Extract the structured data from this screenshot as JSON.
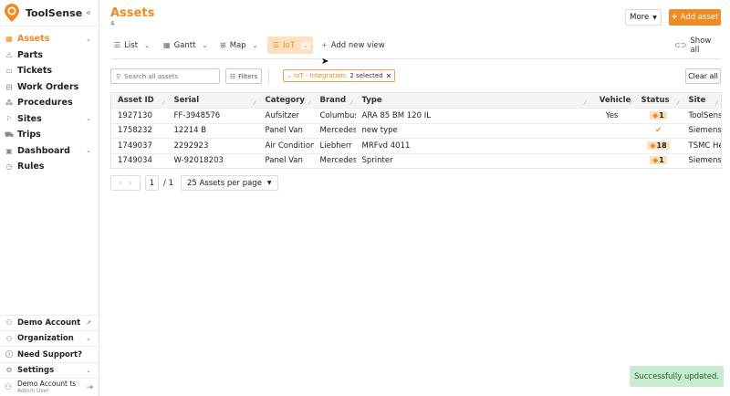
{
  "app": {
    "name": "ToolSense",
    "accent": "#f08a24"
  },
  "sidebar": {
    "items": [
      {
        "label": "Assets",
        "icon": "grid-icon",
        "chevron": true,
        "active": true
      },
      {
        "label": "Parts",
        "icon": "parts-icon"
      },
      {
        "label": "Tickets",
        "icon": "ticket-icon"
      },
      {
        "label": "Work Orders",
        "icon": "briefcase-icon"
      },
      {
        "label": "Procedures",
        "icon": "procedures-icon"
      },
      {
        "label": "Sites",
        "icon": "flag-icon",
        "chevron": true
      },
      {
        "label": "Trips",
        "icon": "truck-icon"
      },
      {
        "label": "Dashboard",
        "icon": "dashboard-icon",
        "chevron": true
      },
      {
        "label": "Rules",
        "icon": "rules-icon"
      }
    ],
    "bottom": [
      {
        "label": "Demo Account",
        "icon": "account-icon"
      },
      {
        "label": "Organization",
        "icon": "organization-icon"
      },
      {
        "label": "Need Support?",
        "icon": "support-icon"
      },
      {
        "label": "Settings",
        "icon": "gear-icon"
      }
    ],
    "user": {
      "name": "Demo Account ts",
      "role": "Admin User"
    }
  },
  "header": {
    "title": "Assets",
    "count": "4",
    "more_label": "More",
    "add_label": "Add asset"
  },
  "tabs": [
    {
      "label": "List"
    },
    {
      "label": "Gantt"
    },
    {
      "label": "Map"
    },
    {
      "label": "IoT",
      "active": true
    }
  ],
  "add_view_label": "Add new view",
  "show_all_label": "Show all",
  "filters": {
    "search_placeholder": "Search all assets",
    "filters_label": "Filters",
    "chip_label": "IoT - Integration:",
    "chip_value": "2 selected",
    "clear_label": "Clear all"
  },
  "table": {
    "columns": [
      "Asset ID",
      "Serial",
      "Category",
      "Brand",
      "Type",
      "Vehicle",
      "Status",
      "Site"
    ],
    "rows": [
      {
        "id": "1927130",
        "serial": "FF-3948576",
        "category": "Aufsitzer",
        "brand": "Columbus",
        "type": "ARA 85 BM 120 IL",
        "vehicle": "Yes",
        "status": "1",
        "site": "ToolSense"
      },
      {
        "id": "1758232",
        "serial": "12214 B",
        "category": "Panel Van",
        "brand": "Mercedes",
        "type": "new type",
        "vehicle": "",
        "status": "check",
        "site": "Siemens"
      },
      {
        "id": "1749037",
        "serial": "2292923",
        "category": "Air Conditione",
        "brand": "Liebherr",
        "type": "MRFvd 4011",
        "vehicle": "",
        "status": "18",
        "site": "TSMC Hea"
      },
      {
        "id": "1749034",
        "serial": "W-92018203",
        "category": "Panel Van",
        "brand": "Mercedes",
        "type": "Sprinter",
        "vehicle": "",
        "status": "1",
        "site": "Siemens"
      }
    ]
  },
  "pager": {
    "page": "1",
    "total": "/ 1",
    "per_page": "25 Assets per page"
  },
  "toast": "Successfully updated."
}
